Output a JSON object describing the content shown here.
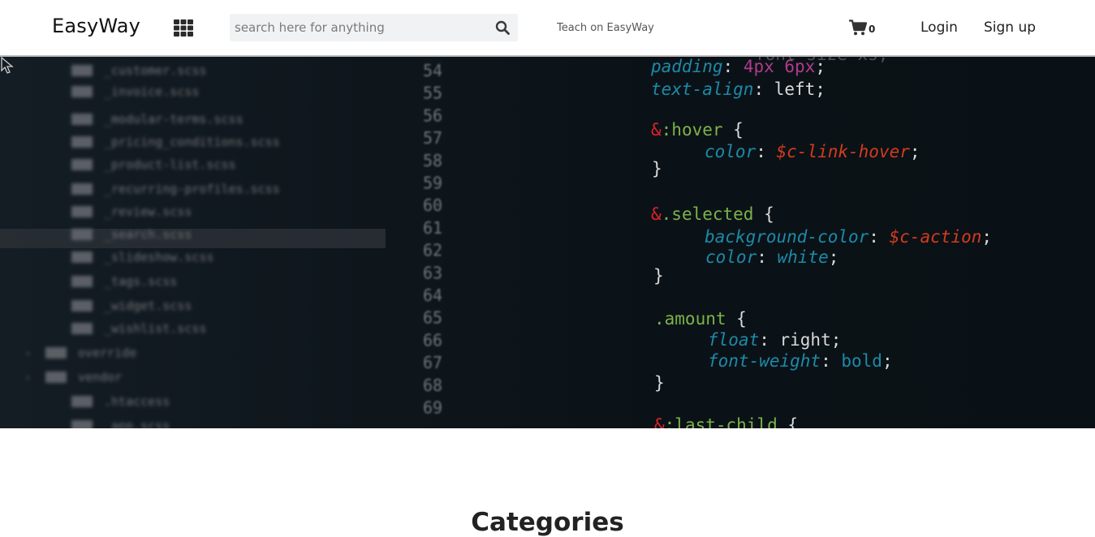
{
  "navbar": {
    "brand": "EasyWay",
    "grid_icon": "apps-grid-icon",
    "search": {
      "placeholder": "search here for anything",
      "value": "",
      "icon": "search-icon"
    },
    "teach_link": "Teach on EasyWay",
    "cart": {
      "icon": "shopping-cart-icon",
      "count": "0"
    },
    "login_label": "Login",
    "signup_label": "Sign up"
  },
  "hero": {
    "file_tree": [
      "_customer.scss",
      "_invoice.scss",
      "_modular-terms.scss",
      "_pricing_conditions.scss",
      "_product-list.scss",
      "_recurring-profiles.scss",
      "_review.scss",
      "_search.scss",
      "_slideshow.scss",
      "_tags.scss",
      "_widget.scss",
      "_wishlist.scss",
      "override",
      "vendor",
      ".htaccess",
      "_app.scss"
    ],
    "line_numbers": [
      "54",
      "55",
      "56",
      "57",
      "58",
      "59",
      "60",
      "61",
      "62",
      "63",
      "64",
      "65",
      "66",
      "67",
      "68",
      "69"
    ],
    "code_lines": [
      "padding: 4px 6px;",
      "text-align: left;",
      "&:hover {",
      "color: $c-link-hover;",
      "}",
      "&.selected {",
      "background-color: $c-action;",
      "color: white;",
      "}",
      ".amount {",
      "float: right;",
      "font-weight: bold;",
      "}",
      "&:last-child {"
    ],
    "colors": {
      "property": "#1f8aa8",
      "value": "#d9d9d9",
      "variable": "#d43a1e",
      "keyword": "#b13a8a",
      "selector": "#7bb24a",
      "ampersand": "#e0222a"
    }
  },
  "categories": {
    "title": "Categories"
  }
}
